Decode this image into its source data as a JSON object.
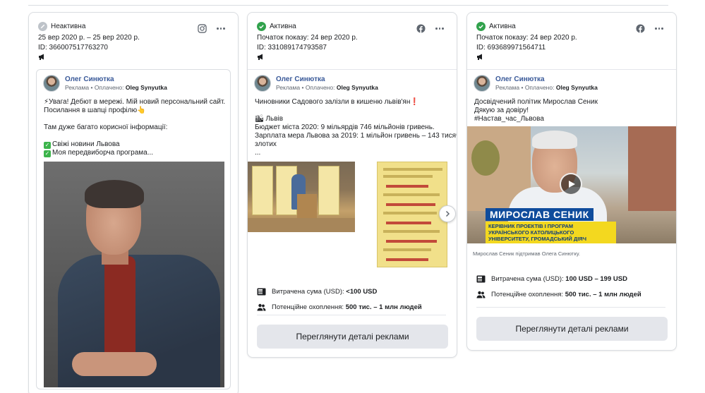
{
  "cards": [
    {
      "status": "Неактивна",
      "status_color": "#bec3c9",
      "dates": "25 вер 2020 р. – 25 вер 2020 р.",
      "id": "ID: 366007517763270",
      "platform_icon": "instagram-icon",
      "page_name": "Олег Синютка",
      "sponsored": "Реклама",
      "paid_by": "Оплачено:",
      "payer": "Oleg Synyutka",
      "text_lines": [
        "⚡Увага! Дебют в мережі. Мій новий персональний сайт.",
        "Посилання в шапці профілю👆",
        "",
        "Там дуже багато корисної інформації:",
        ""
      ],
      "checklist": [
        "Свіжі новини Львова",
        "Моя передвиборча програма..."
      ]
    },
    {
      "status": "Активна",
      "status_color": "#31a24c",
      "dates": "Початок показу: 24 вер 2020 р.",
      "id": "ID: 331089174793587",
      "platform_icon": "facebook-icon",
      "page_name": "Олег Синютка",
      "sponsored": "Реклама",
      "paid_by": "Оплачено:",
      "payer": "Oleg Synyutka",
      "text_lines": [
        "Чиновники Садового залізли в кишеню львів'ян❗",
        "",
        "🏙 Львів",
        "Бюджет міста 2020: 9 мільярдів 746 мільйонів гривень.",
        "Зарплата мера Львова за 2019: 1 мільйон гривень – 143 тисячі",
        "злотих",
        "..."
      ],
      "spend_label": "Витрачена сума (USD):",
      "spend_value": "<100 USD",
      "reach_label": "Потенційне охоплення:",
      "reach_value": "500 тис. – 1 млн людей",
      "button_label": "Переглянути деталі реклами"
    },
    {
      "status": "Активна",
      "status_color": "#31a24c",
      "dates": "Початок показу: 24 вер 2020 р.",
      "id": "ID: 693689971564711",
      "platform_icon": "facebook-icon",
      "page_name": "Олег Синютка",
      "sponsored": "Реклама",
      "paid_by": "Оплачено:",
      "payer": "Oleg Synyutka",
      "text_lines": [
        "Досвідчений політик Мирослав Сеник",
        "Дякую за довіру!",
        "#Настав_час_Львова"
      ],
      "video_banner_name": "МИРОСЛАВ СЕНИК",
      "video_banner_role": "КЕРІВНИК ПРОЕКТІВ І ПРОГРАМ УКРАЇНСЬКОГО КАТОЛИЦЬКОГО УНІВЕРСИТЕТУ, ГРОМАДСЬКИЙ ДІЯЧ",
      "video_caption": "Мирослав Сеник підтримав Олега Синютку.",
      "spend_label": "Витрачена сума (USD):",
      "spend_value": "100 USD – 199 USD",
      "reach_label": "Потенційне охоплення:",
      "reach_value": "500 тис. – 1 млн людей",
      "button_label": "Переглянути деталі реклами"
    }
  ]
}
